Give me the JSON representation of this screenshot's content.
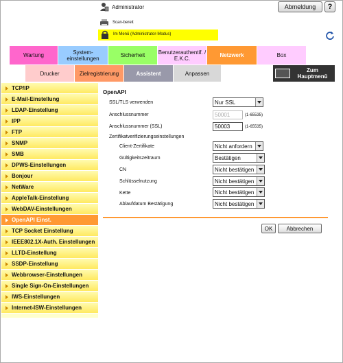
{
  "header": {
    "admin_name": "Administrator",
    "logout_label": "Abmeldung",
    "help_label": "?",
    "status_text": "Scan-bereit",
    "mode_text": "Im Menü (Administrator-Modus)"
  },
  "tabs": {
    "wartung": "Wartung",
    "system_1": "System-",
    "system_2": "einstellungen",
    "sicherheit": "Sicherheit",
    "benutzer_1": "Benutzerauthentif. /",
    "benutzer_2": "E.K.C.",
    "netzwerk": "Netzwerk",
    "box": "Box"
  },
  "subtabs": {
    "drucker": "Drucker",
    "ziel": "Zielregistrierung",
    "assistent": "Assistent",
    "anpassen": "Anpassen",
    "menu_1": "Zum",
    "menu_2": "Hauptmenü"
  },
  "sidebar": {
    "items": [
      "TCP/IP",
      "E-Mail-Einstellung",
      "LDAP-Einstellung",
      "IPP",
      "FTP",
      "SNMP",
      "SMB",
      "DPWS-Einstellungen",
      "Bonjour",
      "NetWare",
      "AppleTalk-Einstellung",
      "WebDAV-Einstellungen",
      "OpenAPI Einst.",
      "TCP Socket Einstellung",
      "IEEE802.1X-Auth. Einstellungen",
      "LLTD-Einstellung",
      "SSDP-Einstellung",
      "Webbrowser-Einstellungen",
      "Single Sign-On-Einstellungen",
      "IWS-Einstellungen",
      "Internet-ISW-Einstellungen"
    ],
    "active_index": 12
  },
  "form": {
    "title": "OpenAPI",
    "ssl_label": "SSL/TLS verwenden",
    "ssl_value": "Nur SSL",
    "port_label": "Anschlussnummer",
    "port_value": "50001",
    "port_hint": "(1-65535)",
    "ssl_port_label": "Anschlussnummer (SSL)",
    "ssl_port_value": "50003",
    "ssl_port_hint": "(1-65535)",
    "cert_label": "Zertifikatverifizierungseinstellungen",
    "client_cert_label": "Client-Zertifikate",
    "client_cert_value": "Nicht anfordern",
    "validity_label": "Gültigkeitszeitraum",
    "validity_value": "Bestätigen",
    "cn_label": "CN",
    "cn_value": "Nicht bestätigen",
    "usage_label": "Schlüsselnutzung",
    "usage_value": "Nicht bestätigen",
    "chain_label": "Kette",
    "chain_value": "Nicht bestätigen",
    "expiry_label": "Ablaufdatum Bestätigung",
    "expiry_value": "Nicht bestätigen",
    "ok_label": "OK",
    "cancel_label": "Abbrechen"
  },
  "colors": {
    "accent": "#ff9933",
    "sidebar_bg": "#ffffcc",
    "mode_bar": "#ffff00"
  }
}
